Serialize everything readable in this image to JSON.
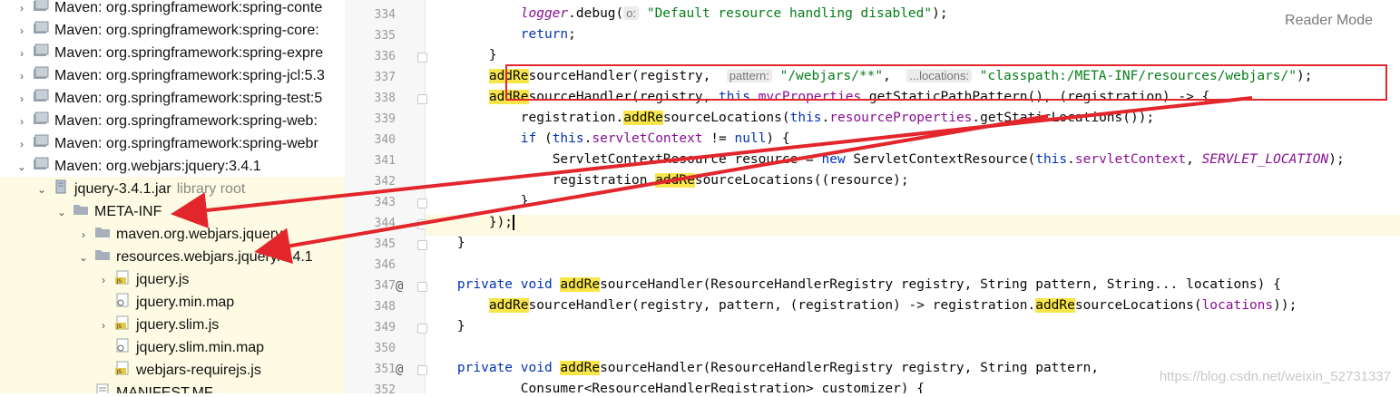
{
  "project_tree": {
    "rows": [
      {
        "label": "Maven: org.springframework:spring-conte",
        "muted": "",
        "expanded": false,
        "icon": "library-icon"
      },
      {
        "label": "Maven: org.springframework:spring-core:",
        "muted": "",
        "expanded": false,
        "icon": "library-icon"
      },
      {
        "label": "Maven: org.springframework:spring-expre",
        "muted": "",
        "expanded": false,
        "icon": "library-icon"
      },
      {
        "label": "Maven: org.springframework:spring-jcl:5.3",
        "muted": "",
        "expanded": false,
        "icon": "library-icon"
      },
      {
        "label": "Maven: org.springframework:spring-test:5",
        "muted": "",
        "expanded": false,
        "icon": "library-icon"
      },
      {
        "label": "Maven: org.springframework:spring-web:",
        "muted": "",
        "expanded": false,
        "icon": "library-icon"
      },
      {
        "label": "Maven: org.springframework:spring-webr",
        "muted": "",
        "expanded": false,
        "icon": "library-icon"
      },
      {
        "label": "Maven: org.webjars:jquery:3.4.1",
        "muted": "",
        "expanded": true,
        "icon": "library-icon"
      },
      {
        "label": "jquery-3.4.1.jar",
        "muted": "library root",
        "expanded": true,
        "icon": "jar-icon"
      },
      {
        "label": "META-INF",
        "muted": "",
        "expanded": true,
        "icon": "folder-icon"
      },
      {
        "label": "maven.org.webjars.jquery",
        "muted": "",
        "expanded": false,
        "icon": "folder-icon"
      },
      {
        "label": "resources.webjars.jquery.3.4.1",
        "muted": "",
        "expanded": true,
        "icon": "folder-icon"
      },
      {
        "label": "jquery.js",
        "muted": "",
        "expanded": false,
        "icon": "js-file-icon"
      },
      {
        "label": "jquery.min.map",
        "muted": "",
        "expanded": null,
        "icon": "map-file-icon"
      },
      {
        "label": "jquery.slim.js",
        "muted": "",
        "expanded": false,
        "icon": "js-file-icon"
      },
      {
        "label": "jquery.slim.min.map",
        "muted": "",
        "expanded": null,
        "icon": "map-file-icon"
      },
      {
        "label": "webjars-requirejs.js",
        "muted": "",
        "expanded": null,
        "icon": "js-file-icon"
      },
      {
        "label": "MANIFEST.MF",
        "muted": "",
        "expanded": null,
        "icon": "manifest-file-icon"
      }
    ]
  },
  "editor": {
    "reader_mode": "Reader Mode",
    "line_numbers": [
      "334",
      "335",
      "336",
      "337",
      "338",
      "339",
      "340",
      "341",
      "342",
      "343",
      "344",
      "345",
      "346",
      "347",
      "348",
      "349",
      "350",
      "351",
      "352"
    ],
    "annotations": {
      "347": "@",
      "351": "@"
    },
    "lines": [
      {
        "n": "334",
        "text": "            logger.debug( o: \"Default resource handling disabled\");"
      },
      {
        "n": "335",
        "text": "            return;"
      },
      {
        "n": "336",
        "text": "        }"
      },
      {
        "n": "337",
        "text": "        addResourceHandler(registry,  pattern: \"/webjars/**\",  ...locations: \"classpath:/META-INF/resources/webjars/\");"
      },
      {
        "n": "338",
        "text": "        addResourceHandler(registry, this.mvcProperties.getStaticPathPattern(), (registration) -> {"
      },
      {
        "n": "339",
        "text": "            registration.addResourceLocations(this.resourceProperties.getStaticLocations());"
      },
      {
        "n": "340",
        "text": "            if (this.servletContext != null) {"
      },
      {
        "n": "341",
        "text": "                ServletContextResource resource = new ServletContextResource(this.servletContext, SERVLET_LOCATION);"
      },
      {
        "n": "342",
        "text": "                registration.addResourceLocations(resource);"
      },
      {
        "n": "343",
        "text": "            }"
      },
      {
        "n": "344",
        "text": "        });"
      },
      {
        "n": "345",
        "text": "    }"
      },
      {
        "n": "346",
        "text": ""
      },
      {
        "n": "347",
        "text": "    private void addResourceHandler(ResourceHandlerRegistry registry, String pattern, String... locations) {"
      },
      {
        "n": "348",
        "text": "        addResourceHandler(registry, pattern, (registration) -> registration.addResourceLocations(locations));"
      },
      {
        "n": "349",
        "text": "    }"
      },
      {
        "n": "350",
        "text": ""
      },
      {
        "n": "351",
        "text": "    private void addResourceHandler(ResourceHandlerRegistry registry, String pattern,"
      },
      {
        "n": "352",
        "text": "            Consumer<ResourceHandlerRegistration> customizer) {"
      }
    ],
    "tokens": {
      "logger": "logger",
      "debug": ".debug(",
      "hint_o": "o:",
      "default_msg": "\"Default resource handling disabled\"",
      "close_semi": ");",
      "return": "return",
      "semi": ";",
      "rbrace": "}",
      "addRe": "addRe",
      "sourceHandler": "sourceHandler",
      "registry_comma": "(registry, ",
      "hint_pattern": "pattern:",
      "webjars_pattern": "\"/webjars/**\"",
      "comma": ",",
      "hint_locations": "...locations:",
      "classpath_str": "\"classpath:/META-INF/resources/webjars/\"",
      "this": "this",
      "mvcProperties": "mvcProperties",
      "getStatic": ".getStaticPathPattern(), (registration) -> {",
      "registration": "registration.",
      "addRe2": "addRe",
      "sourceLocations": "sourceLocations(",
      "resourceProperties": "resourceProperties",
      "getStaticLocations": ".getStaticLocations());",
      "if": "if",
      "paren_open": " (",
      "servletContext": "servletContext",
      "not_null": " != ",
      "null": "null",
      "paren_brace": ") {",
      "scr_decl": "ServletContextResource resource = ",
      "new": "new",
      "scr_call": " ServletContextResource(",
      "servlet_location": "SERVLET_LOCATION",
      "call_close": ");",
      "resource_close": "(resource);",
      "close_lambda": "});",
      "private": "private",
      "void": "void",
      "sig_347": "(ResourceHandlerRegistry registry, String pattern, String... locations) {",
      "body_348a": "(registry, pattern, (registration) -> registration.",
      "locations": "locations",
      "body_348b": "));",
      "sig_351": "(ResourceHandlerRegistry registry, String pattern,",
      "sig_352": "Consumer<ResourceHandlerRegistration> customizer) {"
    }
  },
  "watermark": "https://blog.csdn.net/weixin_52731337",
  "colors": {
    "annotation_red": "#e3262b",
    "search_highlight": "#f8e54a",
    "keyword": "#0033b3",
    "string": "#067d17",
    "field": "#871094"
  }
}
